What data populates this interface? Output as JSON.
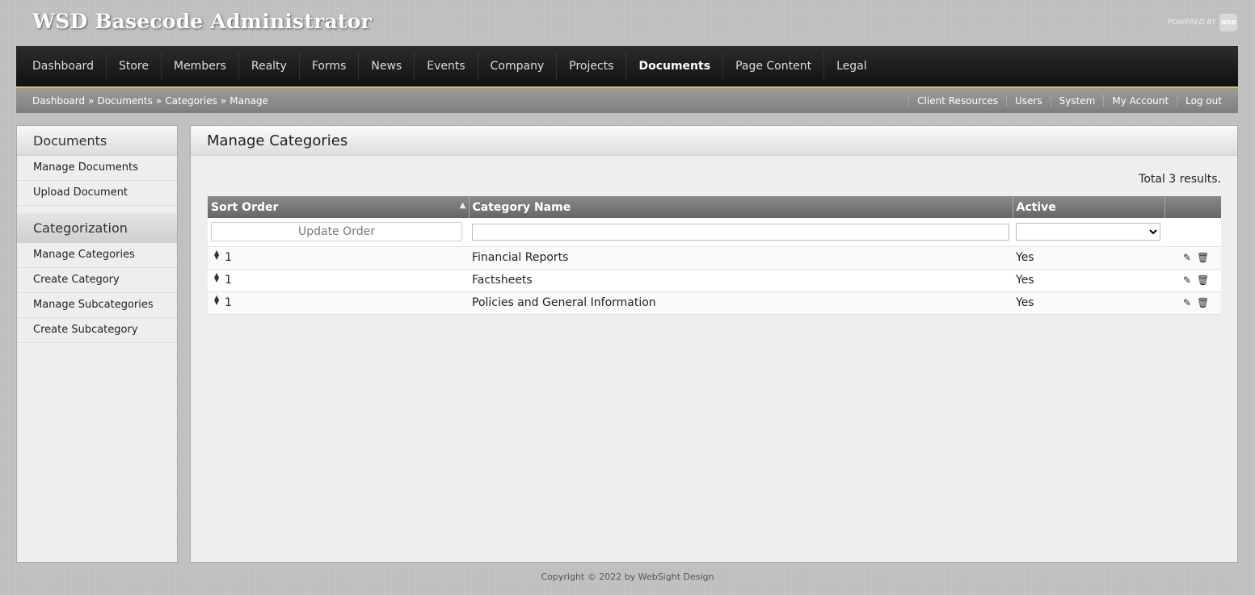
{
  "app": {
    "title": "WSD Basecode Administrator",
    "powered_by": "POWERED BY",
    "logo_text": "WSD"
  },
  "topnav": {
    "items": [
      {
        "label": "Dashboard"
      },
      {
        "label": "Store"
      },
      {
        "label": "Members"
      },
      {
        "label": "Realty"
      },
      {
        "label": "Forms"
      },
      {
        "label": "News"
      },
      {
        "label": "Events"
      },
      {
        "label": "Company"
      },
      {
        "label": "Projects"
      },
      {
        "label": "Documents",
        "active": true
      },
      {
        "label": "Page Content"
      },
      {
        "label": "Legal"
      }
    ]
  },
  "breadcrumb": {
    "items": [
      "Dashboard",
      "»",
      "Documents",
      "»",
      "Categories",
      "»",
      "Manage"
    ]
  },
  "util_links": [
    "Client Resources",
    "Users",
    "System",
    "My Account",
    "Log out"
  ],
  "sidebar": {
    "section1": {
      "title": "Documents",
      "items": [
        "Manage Documents",
        "Upload Document"
      ]
    },
    "section2": {
      "title": "Categorization",
      "items": [
        "Manage Categories",
        "Create Category",
        "Manage Subcategories",
        "Create Subcategory"
      ]
    }
  },
  "main": {
    "title": "Manage Categories",
    "total": "Total 3 results.",
    "columns": [
      "Sort Order",
      "Category Name",
      "Active",
      ""
    ],
    "update_order_label": "Update Order",
    "rows": [
      {
        "sort": "1",
        "name": "Financial Reports",
        "active": "Yes"
      },
      {
        "sort": "1",
        "name": "Factsheets",
        "active": "Yes"
      },
      {
        "sort": "1",
        "name": "Policies and General Information",
        "active": "Yes"
      }
    ],
    "icons": {
      "drag": "drag-handle-icon",
      "edit": "pencil-icon",
      "delete": "trash-icon",
      "sort": "sort-asc-icon"
    }
  },
  "footer": {
    "copyright": "Copyright © 2022 by WebSight Design"
  }
}
